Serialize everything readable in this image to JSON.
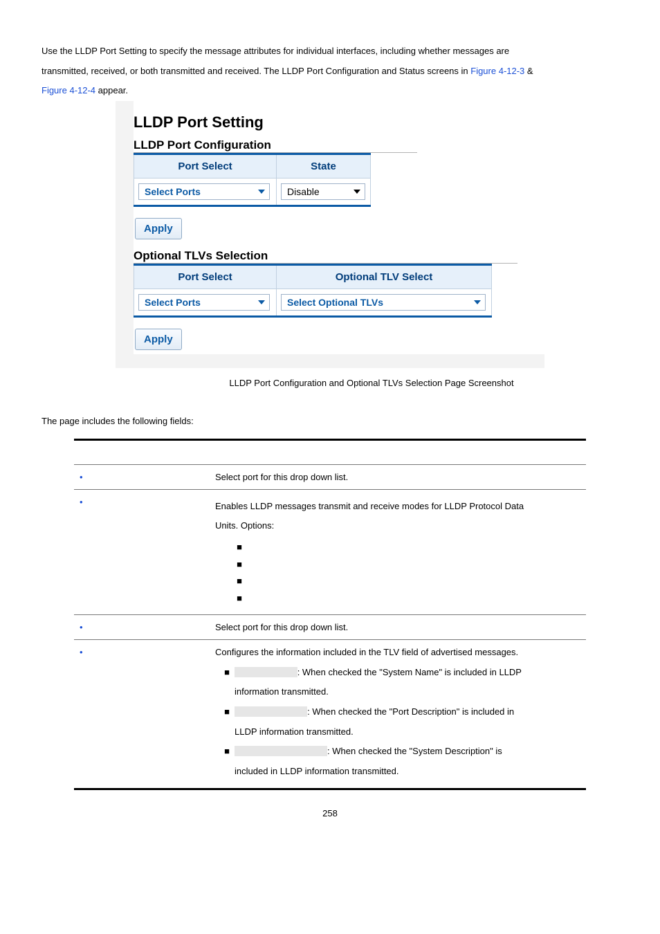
{
  "intro": {
    "line1_a": "Use the LLDP Port Setting to specify the message attributes for individual interfaces, including whether messages are",
    "line2_a": "transmitted, received, or both transmitted and received. The LLDP Port Configuration and Status screens in ",
    "fig_a": "Figure 4-12-3",
    "amp": " & ",
    "fig_b": "Figure 4-12-4",
    "appear": " appear."
  },
  "screenshot": {
    "title": "LLDP Port Setting",
    "section1": "LLDP Port Configuration",
    "th_port": "Port Select",
    "th_state": "State",
    "dd_ports": "Select Ports",
    "dd_state": "Disable",
    "apply": "Apply",
    "section2": "Optional TLVs Selection",
    "th_port2": "Port Select",
    "th_tlv": "Optional TLV Select",
    "dd_ports2": "Select Ports",
    "dd_tlv": "Select Optional TLVs"
  },
  "caption_text": "LLDP Port Configuration and Optional TLVs Selection Page Screenshot",
  "fields_label": "The page includes the following fields:",
  "desc": {
    "rows": [
      {
        "desc": "Select port for this drop down list."
      },
      {
        "desc_a": "Enables LLDP messages transmit and receive modes for LLDP Protocol Data",
        "desc_b": "Units. Options:"
      },
      {
        "desc": "Select port for this drop down list."
      },
      {
        "desc": "Configures the information included in the TLV field of advertised messages.",
        "bullets": [
          {
            "after": ": When checked the \"System Name\" is included in LLDP",
            "cont": "information transmitted."
          },
          {
            "after": ": When checked the \"Port Description\" is included in",
            "cont": "LLDP information transmitted."
          },
          {
            "after": ": When checked the \"System Description\" is",
            "cont": "included in LLDP information transmitted."
          }
        ]
      }
    ]
  },
  "page_number": "258"
}
